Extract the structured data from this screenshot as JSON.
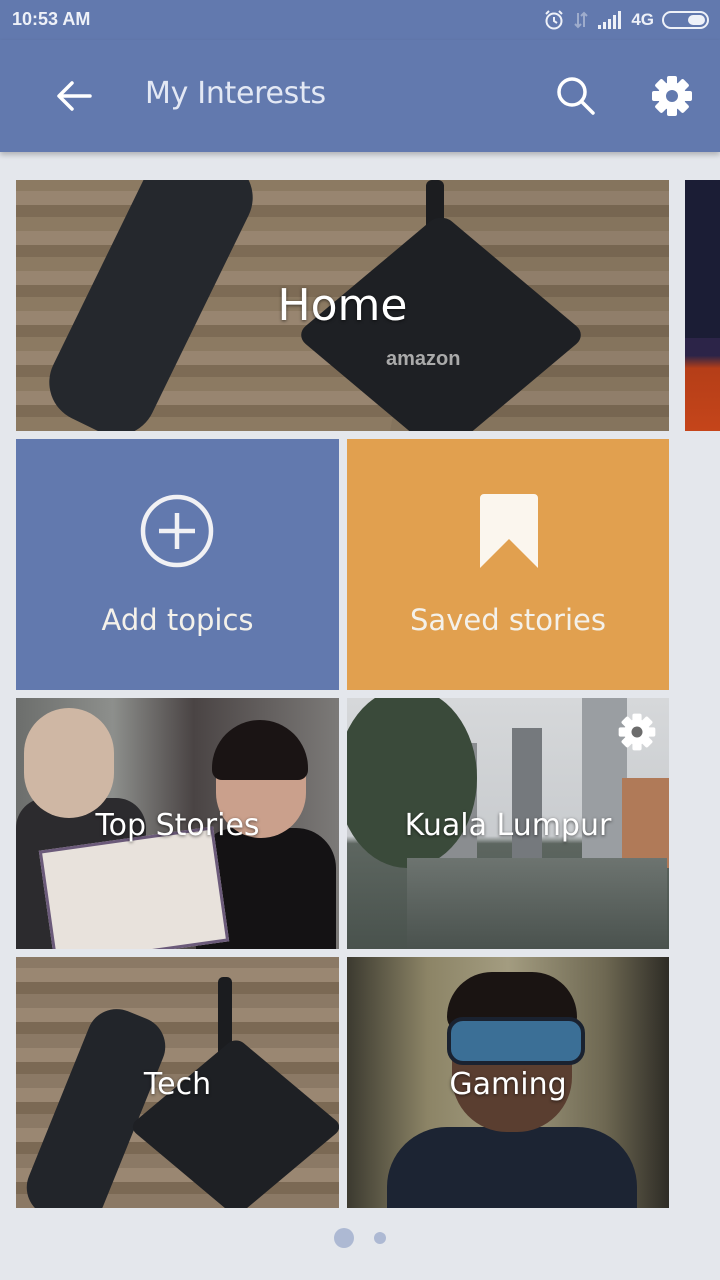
{
  "status_bar": {
    "time": "10:53 AM",
    "network": "4G",
    "icons": [
      "alarm-icon",
      "data-arrows-icon",
      "signal-icon",
      "battery-icon"
    ]
  },
  "app_bar": {
    "title": "My Interests",
    "back_icon": "arrow-left-icon",
    "search_icon": "search-icon",
    "settings_icon": "gear-icon",
    "color": "#6279ae"
  },
  "tiles": {
    "home": {
      "label": "Home"
    },
    "add_topics": {
      "label": "Add topics",
      "icon": "plus-circle-icon",
      "color": "#6279ae"
    },
    "saved_stories": {
      "label": "Saved stories",
      "icon": "bookmark-icon",
      "color": "#e1a04f"
    },
    "top_stories": {
      "label": "Top Stories"
    },
    "kuala_lumpur": {
      "label": "Kuala Lumpur",
      "icon": "gear-icon"
    },
    "tech": {
      "label": "Tech"
    },
    "gaming": {
      "label": "Gaming"
    }
  },
  "photo_text": {
    "home_brand": "amazon"
  },
  "pager": {
    "pages": 2,
    "current": 1
  }
}
